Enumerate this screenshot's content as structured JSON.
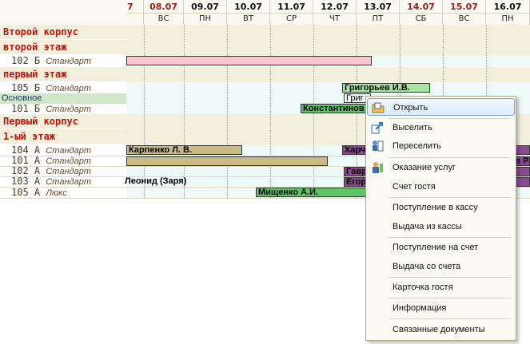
{
  "header": {
    "columns": [
      {
        "date": "7",
        "dow": "",
        "red": true
      },
      {
        "date": "08.07",
        "dow": "ВС",
        "red": true
      },
      {
        "date": "09.07",
        "dow": "ПН",
        "red": false
      },
      {
        "date": "10.07",
        "dow": "ВТ",
        "red": false
      },
      {
        "date": "11.07",
        "dow": "СР",
        "red": false
      },
      {
        "date": "12.07",
        "dow": "ЧТ",
        "red": false
      },
      {
        "date": "13.07",
        "dow": "ПТ",
        "red": false
      },
      {
        "date": "14.07",
        "dow": "СБ",
        "red": true
      },
      {
        "date": "15.07",
        "dow": "ВС",
        "red": true
      },
      {
        "date": "16.07",
        "dow": "ПН",
        "red": false
      }
    ]
  },
  "rows": {
    "building2": "Второй корпус",
    "floor2": "второй этаж",
    "r102b": {
      "num": "102 Б",
      "cat": "Стандарт"
    },
    "floor1a": "первый этаж",
    "r105b": {
      "num": "105 Б",
      "cat": "Стандарт"
    },
    "main_label": "Основное",
    "r101b": {
      "num": "101 Б",
      "cat": "Стандарт"
    },
    "building1": "Первый корпус",
    "floor1b": "1-ый этаж",
    "r104a": {
      "num": "104 А",
      "cat": "Стандарт"
    },
    "r101a": {
      "num": "101 А",
      "cat": "Стандарт"
    },
    "r102a": {
      "num": "102 А",
      "cat": "Стандарт"
    },
    "r103a": {
      "num": "103 А",
      "cat": "Стандарт"
    },
    "r105a": {
      "num": "105 А",
      "cat": "Люкс"
    }
  },
  "bookings": {
    "grigoriev": "Григорьев И.В.",
    "grig_short": "Григ",
    "konstantinov": "Константинов",
    "karpenko": "Карпенко Л. В.",
    "harch": "Харч",
    "p_tail": "s P",
    "gavr": "Гавр",
    "egor": "Егор",
    "leonid": "Леонид (Заря)",
    "mishchenko": "Мищенко А.И."
  },
  "colors": {
    "pink": "#f9c4cc",
    "green": "#5fc567",
    "lightgreen": "#a7e6a0",
    "khaki": "#c8bc84",
    "purple": "#8a4a8e"
  },
  "menu": {
    "items": [
      {
        "label": "Открыть",
        "icon": "open-folder-icon"
      },
      {
        "label": "Выселить",
        "icon": "checkout-icon"
      },
      {
        "label": "Переселить",
        "icon": "move-guest-icon"
      },
      {
        "label": "Оказание услуг",
        "icon": "services-icon"
      },
      {
        "label": "Счет гостя",
        "icon": ""
      },
      {
        "label": "Поступление в кассу",
        "icon": ""
      },
      {
        "label": "Выдача из кассы",
        "icon": ""
      },
      {
        "label": "Поступление на счет",
        "icon": ""
      },
      {
        "label": "Выдача со счета",
        "icon": ""
      },
      {
        "label": "Карточка гостя",
        "icon": ""
      },
      {
        "label": "Информация",
        "icon": ""
      },
      {
        "label": "Связанные документы",
        "icon": ""
      }
    ]
  }
}
